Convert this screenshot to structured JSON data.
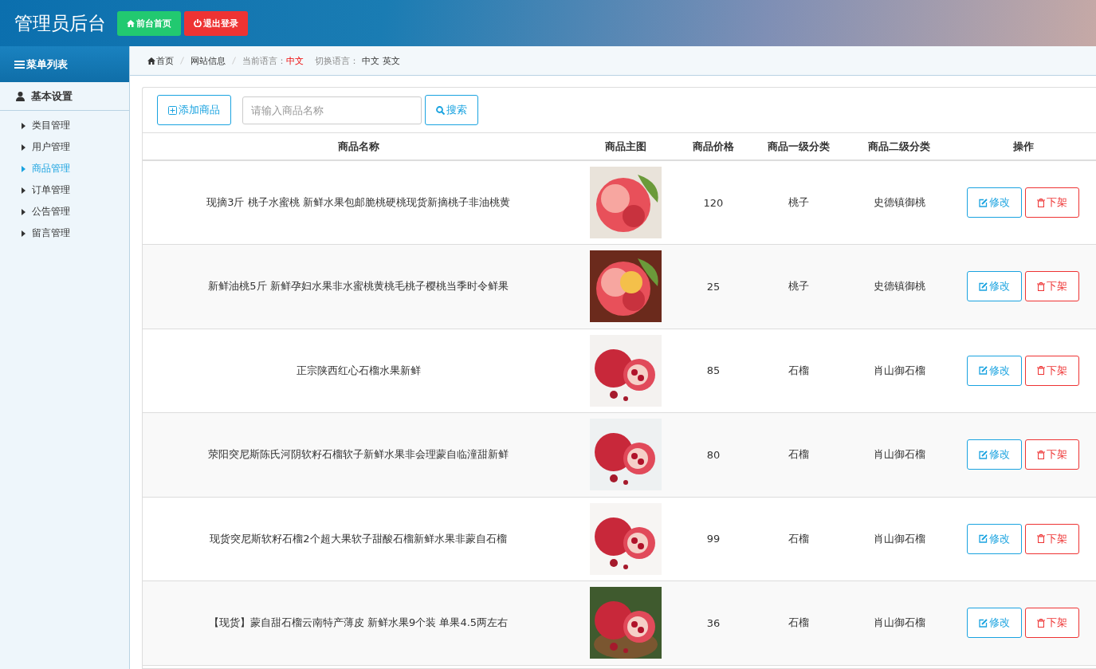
{
  "header": {
    "title": "管理员后台",
    "buttons": [
      {
        "kind": "home",
        "label": "前台首页"
      },
      {
        "kind": "logout",
        "label": "退出登录"
      }
    ]
  },
  "sidebar": {
    "title": "菜单列表",
    "group": "基本设置",
    "items": [
      {
        "label": "类目管理",
        "selected": false
      },
      {
        "label": "用户管理",
        "selected": false
      },
      {
        "label": "商品管理",
        "selected": true
      },
      {
        "label": "订单管理",
        "selected": false
      },
      {
        "label": "公告管理",
        "selected": false
      },
      {
        "label": "留言管理",
        "selected": false
      }
    ]
  },
  "breadcrumb": {
    "home": "首页",
    "page": "网站信息",
    "current_label": "当前语言：",
    "current_value": "中文",
    "switch_label": "切换语言：",
    "languages": [
      "中文",
      "英文"
    ]
  },
  "toolbar": {
    "add_button": "添加商品",
    "search": {
      "placeholder": "请输入商品名称"
    },
    "search_button": "搜索"
  },
  "table": {
    "columns": [
      "商品名称",
      "商品主图",
      "商品价格",
      "商品一级分类",
      "商品二级分类",
      "操作"
    ],
    "rows": [
      {
        "name": "现摘3斤 桃子水蜜桃 新鲜水果包邮脆桃硬桃现货新摘桃子非油桃黄",
        "price": "120",
        "category1": "桃子",
        "category2": "史德镇御桃",
        "edit": "修改",
        "remove": "下架"
      },
      {
        "name": "新鲜油桃5斤 新鲜孕妇水果非水蜜桃黄桃毛桃子樱桃当季时令鲜果",
        "price": "25",
        "category1": "桃子",
        "category2": "史德镇御桃",
        "edit": "修改",
        "remove": "下架"
      },
      {
        "name": "正宗陕西红心石榴水果新鲜",
        "price": "85",
        "category1": "石榴",
        "category2": "肖山御石榴",
        "edit": "修改",
        "remove": "下架"
      },
      {
        "name": "荥阳突尼斯陈氏河阴软籽石榴软子新鲜水果非会理蒙自临潼甜新鲜",
        "price": "80",
        "category1": "石榴",
        "category2": "肖山御石榴",
        "edit": "修改",
        "remove": "下架"
      },
      {
        "name": "现货突尼斯软籽石榴2个超大果软子甜酸石榴新鲜水果非蒙自石榴",
        "price": "99",
        "category1": "石榴",
        "category2": "肖山御石榴",
        "edit": "修改",
        "remove": "下架"
      },
      {
        "name": "【现货】蒙自甜石榴云南特产薄皮 新鲜水果9个装 单果4.5两左右",
        "price": "36",
        "category1": "石榴",
        "category2": "肖山御石榴",
        "edit": "修改",
        "remove": "下架"
      }
    ]
  }
}
